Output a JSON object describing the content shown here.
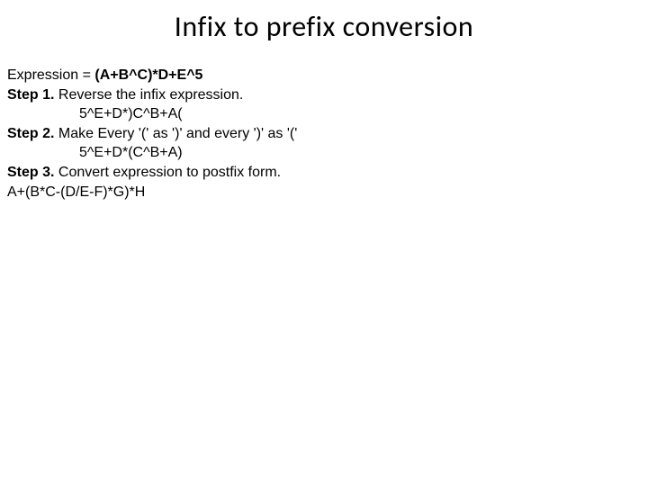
{
  "title": "Infix to prefix conversion",
  "expression_label": "Expression = ",
  "expression_value": "(A+B^C)*D+E^5",
  "step1_label": "Step 1.",
  "step1_text": " Reverse the infix expression.",
  "step1_result": "5^E+D*)C^B+A(",
  "step2_label": "Step 2.",
  "step2_text": " Make Every '(' as ')' and every ')' as '('",
  "step2_result": "5^E+D*(C^B+A)",
  "step3_label": "Step 3.",
  "step3_text": " Convert expression to postfix form.",
  "step3_example": "A+(B*C-(D/E-F)*G)*H"
}
